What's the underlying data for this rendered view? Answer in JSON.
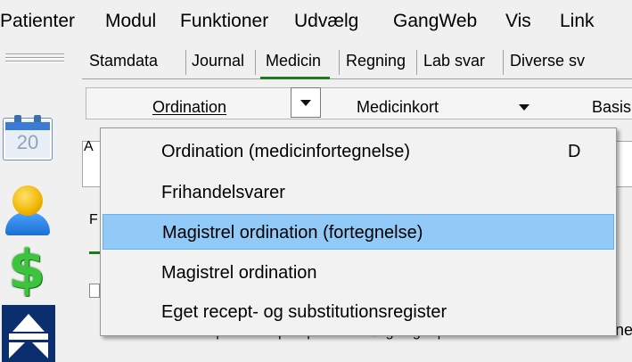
{
  "menubar": {
    "items": [
      "Patienter",
      "Modul",
      "Funktioner",
      "Udvælg",
      "GangWeb",
      "Vis",
      "Link"
    ]
  },
  "lefttoolbar": {
    "calendar_day": "20",
    "icons": [
      "calendar-icon",
      "person-icon",
      "dollar-icon",
      "navy-logo-icon"
    ]
  },
  "tabs": {
    "items": [
      "Stamdata",
      "Journal",
      "Medicin",
      "Regning",
      "Lab svar",
      "Diverse sv"
    ],
    "active": "Medicin"
  },
  "toolbar2": {
    "ordination_label": "Ordination",
    "medicinkort_label": "Medicinkort",
    "basis_label": "Basis"
  },
  "background": {
    "label_a": "A",
    "label_f": "F",
    "bottom_tabs": "| Fila recepter | Fila efterfølgninger |",
    "behind_text": "ne"
  },
  "dropdown": {
    "items": [
      {
        "label": "Ordination (medicinfortegnelse)",
        "shortcut": "D",
        "highlighted": false
      },
      {
        "label": "Frihandelsvarer",
        "shortcut": "",
        "highlighted": false
      },
      {
        "label": "Magistrel ordination (fortegnelse)",
        "shortcut": "",
        "highlighted": true
      },
      {
        "label": "Magistrel ordination",
        "shortcut": "",
        "highlighted": false
      },
      {
        "label": "Eget recept- og substitutionsregister",
        "shortcut": "",
        "highlighted": false
      }
    ]
  },
  "colors": {
    "highlight": "#91c9f7",
    "active_tab_underline": "#1e7a1e",
    "menu_background": "#f2f2f2"
  }
}
